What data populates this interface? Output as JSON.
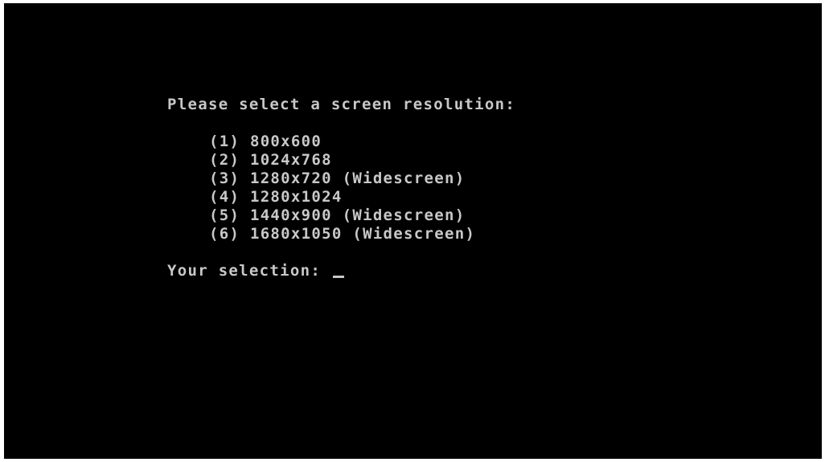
{
  "title": "Please select a screen resolution:",
  "options": [
    {
      "label": "(1) 800x600"
    },
    {
      "label": "(2) 1024x768"
    },
    {
      "label": "(3) 1280x720 (Widescreen)"
    },
    {
      "label": "(4) 1280x1024"
    },
    {
      "label": "(5) 1440x900 (Widescreen)"
    },
    {
      "label": "(6) 1680x1050 (Widescreen)"
    }
  ],
  "selection": {
    "label": "Your selection:",
    "value": ""
  },
  "colors": {
    "background": "#000000",
    "text": "#c8c8c8"
  }
}
